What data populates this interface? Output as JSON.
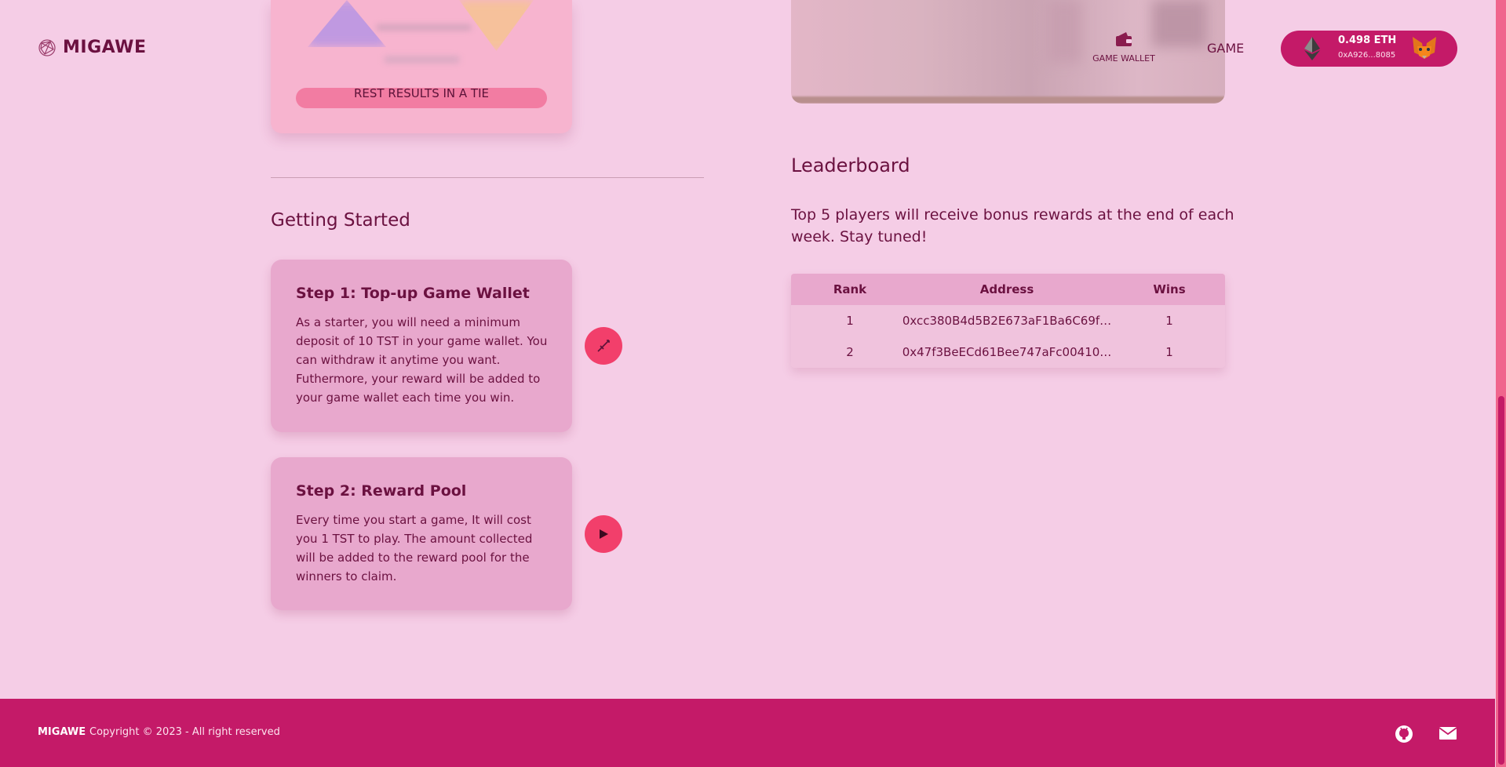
{
  "brand": {
    "name": "MIGAWE",
    "logo_icon": "globe-network-icon"
  },
  "nav": {
    "game_wallet_label": "GAME WALLET",
    "game_wallet_icon": "wallet-icon",
    "game_label": "GAME"
  },
  "wallet": {
    "balance": "0.498 ETH",
    "address": "0xA926...8085",
    "chain_icon": "ethereum-icon",
    "provider_icon": "metamask-fox-icon",
    "color": "#c41a68"
  },
  "hero_partial": {
    "button_label": "REST RESULTS IN A TIE"
  },
  "getting_started": {
    "title": "Getting Started",
    "steps": [
      {
        "title": "Step 1: Top-up Game Wallet",
        "body": "As a starter, you will need a minimum deposit of 10 TST in your game wallet. You can withdraw it anytime you want. Futhermore, your reward will be added to your game wallet each time you win.",
        "action_icon": "sword-icon"
      },
      {
        "title": "Step 2: Reward Pool",
        "body": "Every time you start a game, It will cost you 1 TST to play. The amount collected will be added to the reward pool for the winners to claim.",
        "action_icon": "play-icon"
      }
    ]
  },
  "leaderboard": {
    "title": "Leaderboard",
    "description": "Top 5 players will receive bonus rewards at the end of each week. Stay tuned!",
    "columns": [
      "Rank",
      "Address",
      "Wins"
    ],
    "rows": [
      {
        "rank": "1",
        "address": "0xcc380B4d5B2E673aF1Ba6C69f…",
        "wins": "1"
      },
      {
        "rank": "2",
        "address": "0x47f3BeECd61Bee747aFc00410…",
        "wins": "1"
      }
    ]
  },
  "footer": {
    "brand": "MIGAWE",
    "copyright": "Copyright © 2023 - All right reserved",
    "icons": [
      "github-icon",
      "mail-icon"
    ],
    "color": "#c41a68"
  },
  "theme": {
    "background": "#f5cde6",
    "accent": "#f23f6b",
    "card": "#e8a8cd"
  }
}
